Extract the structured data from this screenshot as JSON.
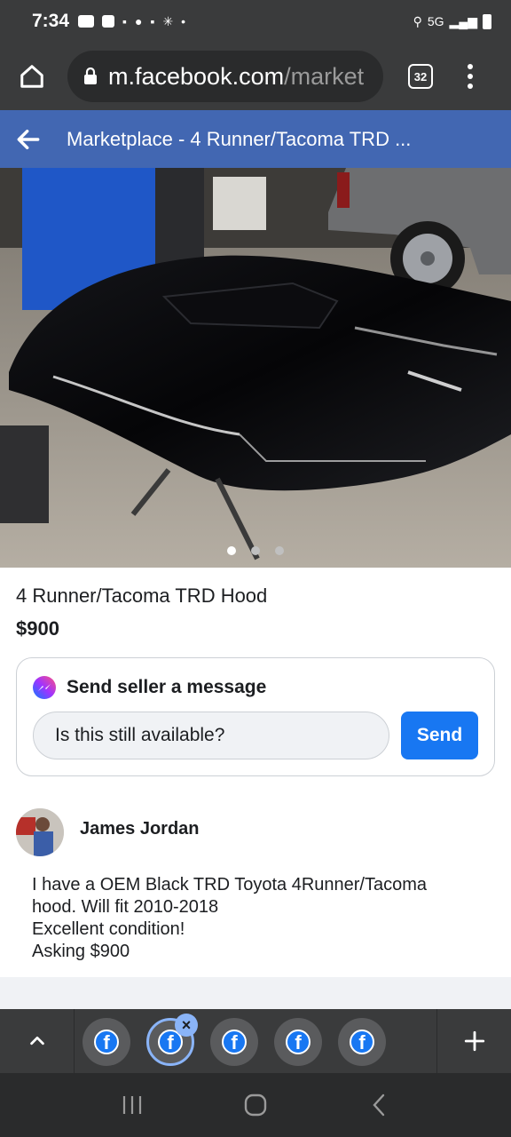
{
  "status_bar": {
    "time": "7:34",
    "network": "5G"
  },
  "browser": {
    "url_domain": "m.facebook.com",
    "url_path": "/market",
    "tab_count": "32"
  },
  "header": {
    "title": "Marketplace - 4 Runner/Tacoma TRD ..."
  },
  "listing": {
    "title": "4 Runner/Tacoma TRD Hood",
    "price": "$900",
    "photo_index": 1,
    "photo_count": 3
  },
  "message": {
    "heading": "Send seller a message",
    "input_value": "Is this still available?",
    "send_label": "Send"
  },
  "seller": {
    "name": "James Jordan",
    "description_lines": [
      "I have a OEM Black TRD Toyota 4Runner/Tacoma",
      "hood. Will fit 2010-2018",
      "Excellent condition!",
      "Asking $900"
    ]
  },
  "tab_switcher": {
    "tabs_shown": 5,
    "active_tab": 2
  },
  "colors": {
    "fb_blue": "#4267b2",
    "send_blue": "#1877f2",
    "chrome_dark": "#3a3b3c"
  }
}
